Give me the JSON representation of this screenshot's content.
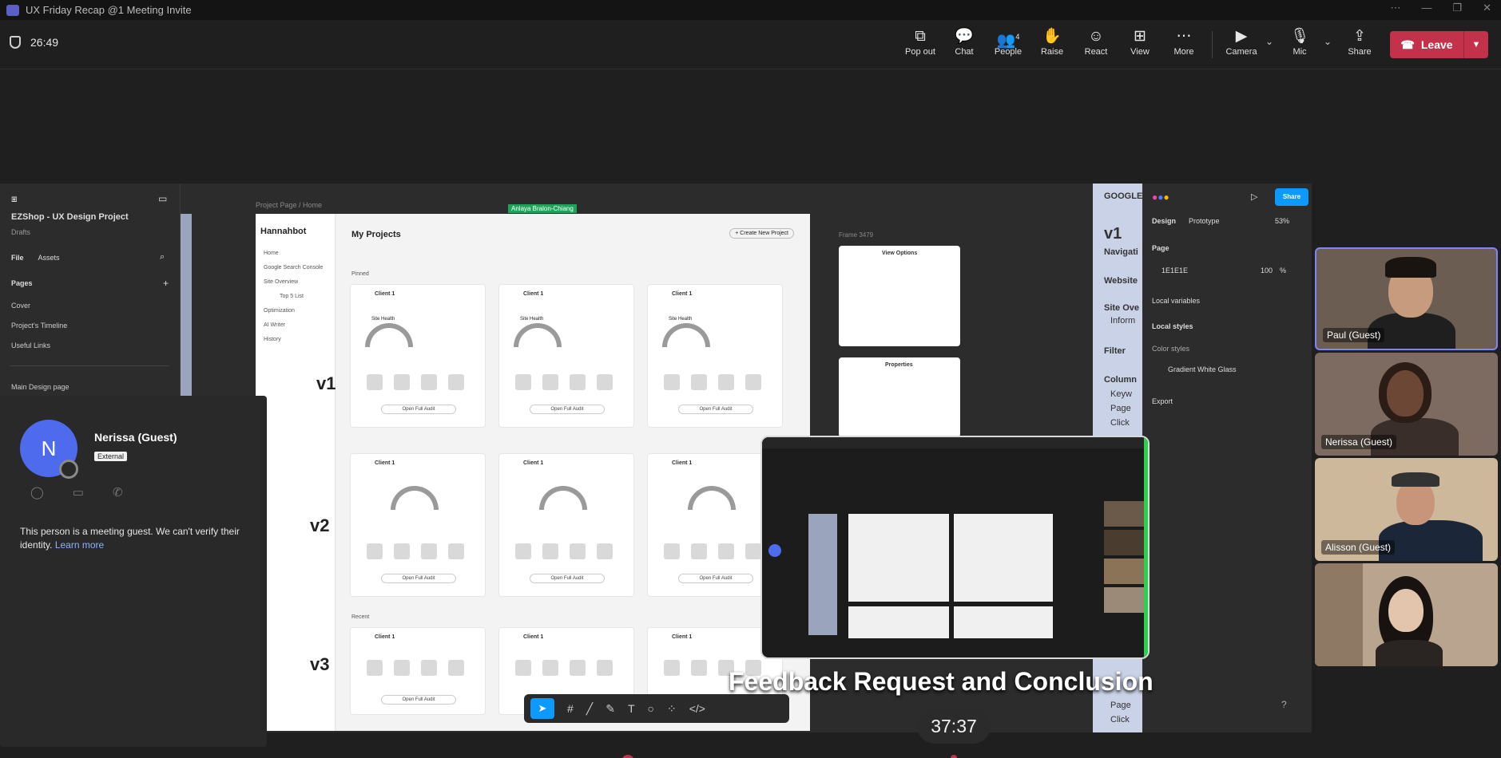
{
  "window": {
    "title": "UX Friday Recap @1 Meeting Invite"
  },
  "toolbar": {
    "elapsed": "26:49",
    "pop_out": "Pop out",
    "chat": "Chat",
    "people": "People",
    "people_count": "4",
    "raise": "Raise",
    "react": "React",
    "view": "View",
    "more": "More",
    "camera": "Camera",
    "mic": "Mic",
    "share": "Share",
    "leave": "Leave"
  },
  "figma": {
    "project": "EZShop - UX Design Project",
    "drafts": "Drafts",
    "tab_file": "File",
    "tab_assets": "Assets",
    "pages_heading": "Pages",
    "pages": [
      "Cover",
      "Project's Timeline",
      "Useful Links",
      "Main Design page"
    ],
    "breadcrumb": "Project Page / Home",
    "cursor_user": "Anlaya Bralon-Chiang",
    "brand": "Hannahbot",
    "nav": [
      "Home",
      "Google Search Console",
      "Site Overview",
      "Top 5 List",
      "Optimization",
      "AI Writer",
      "History"
    ],
    "my_projects": "My Projects",
    "create_btn": "+ Create New Project",
    "card_title": "Client 1",
    "site_health": "Site Health",
    "open_audit": "Open Full Audit",
    "pinned": "Pinned",
    "recent": "Recent",
    "version_labels": [
      "v1",
      "v2",
      "v3"
    ],
    "frame_label": "Frame 3479",
    "view_options": "View Options",
    "properties": "Properties",
    "google_strip": [
      "GOOGLE",
      "v1",
      "Navigati",
      "Website",
      "Site Ove",
      "Inform",
      "Filter",
      "Column",
      "Keyw",
      "Page",
      "Click",
      "Page",
      "Click"
    ],
    "right_tabs_design": "Design",
    "right_tabs_prototype": "Prototype",
    "zoom": "53%",
    "share_btn": "Share",
    "page_label": "Page",
    "page_color": "1E1E1E",
    "page_opacity": "100",
    "page_pct": "%",
    "local_variables": "Local variables",
    "local_styles": "Local styles",
    "color_styles": "Color styles",
    "gradient_style": "Gradient White Glass",
    "export": "Export"
  },
  "guest_card": {
    "initial": "N",
    "name": "Nerissa (Guest)",
    "badge": "External",
    "info": "This person is a meeting guest. We can't verify their identity.",
    "learn_more": "Learn more"
  },
  "caption": "Feedback Request and Conclusion",
  "clock": "37:37",
  "participants": [
    {
      "name": "Paul (Guest)"
    },
    {
      "name": "Nerissa (Guest)"
    },
    {
      "name": "Alisson (Guest)"
    },
    {
      "name": ""
    }
  ],
  "colors": {
    "leave": "#c4314b",
    "accent": "#5b5fc7",
    "figma_blue": "#0d99ff"
  }
}
